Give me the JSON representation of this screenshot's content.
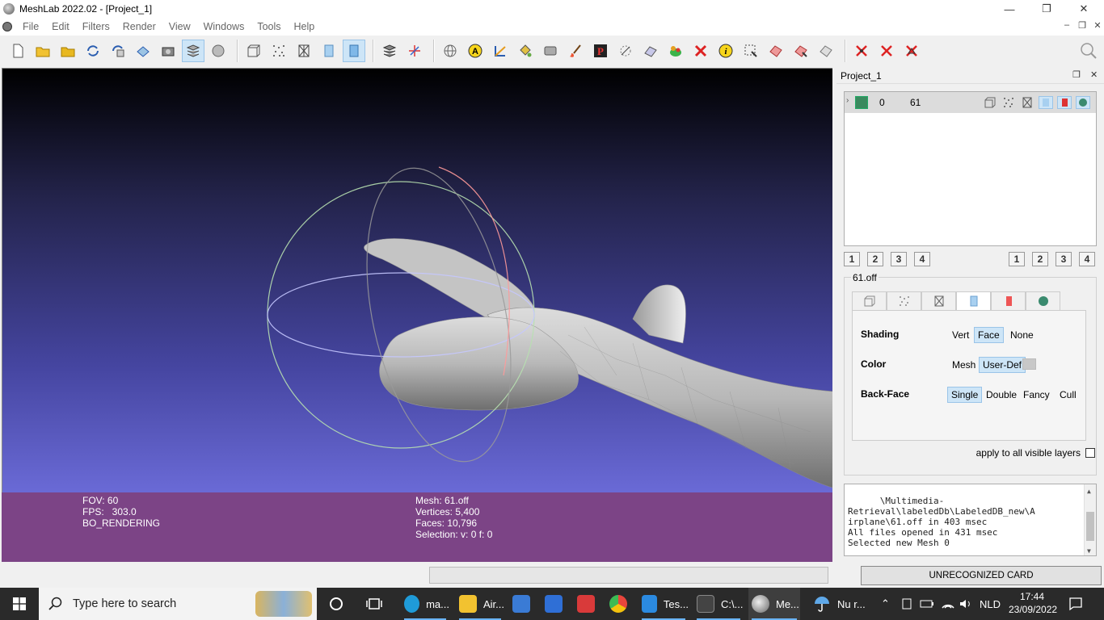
{
  "window": {
    "title": "MeshLab 2022.02 - [Project_1]",
    "minimize": "—",
    "restore": "❐",
    "close": "✕"
  },
  "menu": {
    "items": [
      "File",
      "Edit",
      "Filters",
      "Render",
      "View",
      "Windows",
      "Tools",
      "Help"
    ],
    "mdi_minimize": "–",
    "mdi_restore": "❐",
    "mdi_close": "✕"
  },
  "viewport": {
    "info_left": {
      "fov": "FOV: 60",
      "fps": "FPS:   303.0",
      "mode": "BO_RENDERING"
    },
    "info_right": {
      "mesh": "Mesh: 61.off",
      "vertices": "Vertices: 5,400",
      "faces": "Faces: 10,796",
      "selection": "Selection: v: 0 f: 0"
    }
  },
  "dock": {
    "title": "Project_1",
    "layer": {
      "id": "0",
      "name": "61"
    },
    "num_buttons": [
      "1",
      "2",
      "3",
      "4"
    ],
    "props_title": "61.off",
    "shading": {
      "label": "Shading",
      "options": [
        "Vert",
        "Face",
        "None"
      ],
      "selected": "Face"
    },
    "color": {
      "label": "Color",
      "options": [
        "Mesh",
        "User-Def"
      ],
      "selected": "User-Def",
      "swatch": "#c8c8c8"
    },
    "backface": {
      "label": "Back-Face",
      "options": [
        "Single",
        "Double",
        "Fancy",
        "Cull"
      ],
      "selected": "Single"
    },
    "apply_all": "apply to all visible layers",
    "log": "\\Multimedia-\nRetrieval\\labeledDb\\LabeledDB_new\\A\nirplane\\61.off in 403 msec\nAll files opened in 431 msec\nSelected new Mesh 0"
  },
  "status": {
    "card": "UNRECOGNIZED CARD"
  },
  "taskbar": {
    "search_placeholder": "Type here to search",
    "items": [
      {
        "label": "ma...",
        "icon": "edge-icon",
        "color": "#1f9bd8"
      },
      {
        "label": "Air...",
        "icon": "folder-icon",
        "color": "#f2c230"
      },
      {
        "label": "",
        "icon": "store-icon",
        "color": "#3a7bd5"
      },
      {
        "label": "",
        "icon": "mail-icon",
        "color": "#2f6fd6"
      },
      {
        "label": "",
        "icon": "gift-icon",
        "color": "#d93a3a"
      },
      {
        "label": "",
        "icon": "chrome-icon",
        "color": "#e8453c"
      },
      {
        "label": "Tes...",
        "icon": "vscode-icon",
        "color": "#2b8ae0"
      },
      {
        "label": "C:\\...",
        "icon": "terminal-icon",
        "color": "#444"
      },
      {
        "label": "Me...",
        "icon": "meshlab-icon",
        "color": "#999"
      }
    ],
    "weather": "Nu r...",
    "language": "NLD",
    "time": "17:44",
    "date": "23/09/2022"
  },
  "colors": {
    "viewport_top": "#000000",
    "viewport_bottom": "#6a6ad6",
    "infobar": "#7c4486",
    "selected": "#cde5f7",
    "taskbar": "#2a2a2a"
  }
}
